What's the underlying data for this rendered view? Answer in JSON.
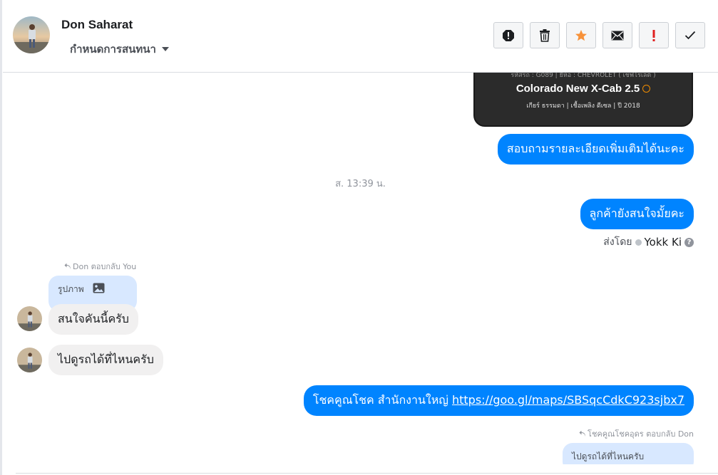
{
  "header": {
    "contact_name": "Don Saharat",
    "conversation_setting": "กำหนดการสนทนา"
  },
  "toolbar": {
    "buttons": [
      {
        "name": "report",
        "icon": "alert-octagon-icon"
      },
      {
        "name": "delete",
        "icon": "trash-icon"
      },
      {
        "name": "star",
        "icon": "star-icon",
        "color": "#f7923a"
      },
      {
        "name": "mark-unread",
        "icon": "envelope-icon"
      },
      {
        "name": "important",
        "icon": "exclamation-icon",
        "color": "#e02020"
      },
      {
        "name": "done",
        "icon": "check-icon"
      }
    ]
  },
  "car_card": {
    "top_text": "รหัสรถ : G089 | ยี่ห้อ : CHEVROLET ( เชฟโรเลต )",
    "title": "Colorado New X-Cab 2.5",
    "meta": "เกียร์ ธรรมดา  |  เชื้อเพลิง ดีเซล  |  ปี 2018"
  },
  "messages": {
    "out_1": "สอบถามรายละเอียดเพิ่มเติมได้นะคะ",
    "timestamp": "ส. 13:39 น.",
    "out_2": "ลูกค้ายังสนใจมั้ยคะ",
    "sent_by_label": "ส่งโดย",
    "sent_by_name": "Yokk Ki",
    "reply_note_1": "Don ตอบกลับ You",
    "reply_quote_1": "รูปภาพ",
    "in_1": "สนใจคันนี้ครับ",
    "in_2": "ไปดูรถได้ที่ไหนครับ",
    "out_3_text": "โชคคูณโชค สำนักงานใหญ่ ",
    "out_3_link": "https://goo.gl/maps/SBSqcCdkC923sjbx7",
    "reply_note_2": "โชคคูณโชคอุดร ตอบกลับ Don",
    "reply_quote_2": "ไปดูรถได้ที่ไหนครับ"
  }
}
